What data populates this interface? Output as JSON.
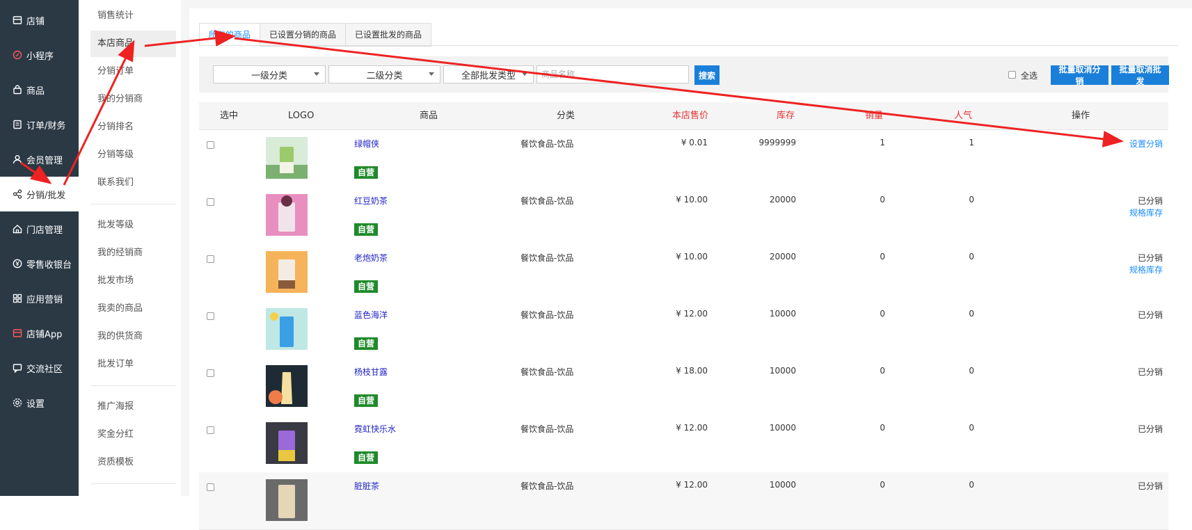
{
  "sidebar": {
    "items": [
      {
        "label": "店铺",
        "icon": "store-icon"
      },
      {
        "label": "小程序",
        "icon": "miniprogram-icon"
      },
      {
        "label": "商品",
        "icon": "bag-icon"
      },
      {
        "label": "订单/财务",
        "icon": "order-icon"
      },
      {
        "label": "会员管理",
        "icon": "user-icon"
      },
      {
        "label": "分销/批发",
        "icon": "share-icon"
      },
      {
        "label": "门店管理",
        "icon": "home-icon"
      },
      {
        "label": "零售收银台",
        "icon": "yen-icon"
      },
      {
        "label": "应用营销",
        "icon": "apps-icon"
      },
      {
        "label": "店铺App",
        "icon": "app-icon"
      },
      {
        "label": "交流社区",
        "icon": "chat-icon"
      },
      {
        "label": "设置",
        "icon": "gear-icon"
      }
    ]
  },
  "subnav": {
    "group1": [
      "销售统计",
      "本店商品",
      "分销订单",
      "我的分销商",
      "分销排名",
      "分销等级",
      "联系我们"
    ],
    "group2": [
      "批发等级",
      "我的经销商",
      "批发市场",
      "我卖的商品",
      "我的供货商",
      "批发订单"
    ],
    "group3": [
      "推广海报",
      "奖金分红",
      "资质模板"
    ]
  },
  "tabs": [
    "所有的商品",
    "已设置分销的商品",
    "已设置批发的商品"
  ],
  "filters": {
    "cat1": "一级分类",
    "cat2": "二级分类",
    "type": "全部批发类型",
    "search_placeholder": "商品名称",
    "search_btn": "搜索",
    "select_all": "全选",
    "batch_cancel_dist": "批量取消分销",
    "batch_cancel_wholesale": "批量取消批发"
  },
  "table": {
    "headers": [
      "选中",
      "LOGO",
      "商品",
      "分类",
      "本店售价",
      "库存",
      "销量",
      "人气",
      "操作"
    ],
    "badge": "自营",
    "rows": [
      {
        "name": "绿帽侠",
        "category": "餐饮食品-饮品",
        "price": "¥ 0.01",
        "stock": "9999999",
        "sales": "1",
        "pop": "1",
        "op1": "设置分销",
        "op2": ""
      },
      {
        "name": "红豆奶茶",
        "category": "餐饮食品-饮品",
        "price": "¥ 10.00",
        "stock": "20000",
        "sales": "0",
        "pop": "0",
        "op1": "已分销",
        "op2": "规格库存"
      },
      {
        "name": "老炮奶茶",
        "category": "餐饮食品-饮品",
        "price": "¥ 10.00",
        "stock": "20000",
        "sales": "0",
        "pop": "0",
        "op1": "已分销",
        "op2": "规格库存"
      },
      {
        "name": "蓝色海洋",
        "category": "餐饮食品-饮品",
        "price": "¥ 12.00",
        "stock": "10000",
        "sales": "0",
        "pop": "0",
        "op1": "已分销",
        "op2": ""
      },
      {
        "name": "杨枝甘露",
        "category": "餐饮食品-饮品",
        "price": "¥ 18.00",
        "stock": "10000",
        "sales": "0",
        "pop": "0",
        "op1": "已分销",
        "op2": ""
      },
      {
        "name": "霓虹快乐水",
        "category": "餐饮食品-饮品",
        "price": "¥ 12.00",
        "stock": "10000",
        "sales": "0",
        "pop": "0",
        "op1": "已分销",
        "op2": ""
      },
      {
        "name": "脏脏茶",
        "category": "餐饮食品-饮品",
        "price": "¥ 12.00",
        "stock": "10000",
        "sales": "0",
        "pop": "0",
        "op1": "已分销",
        "op2": ""
      }
    ]
  },
  "colors": {
    "sidebar": "#2b3945",
    "accent": "#1a7fd9",
    "badge": "#1f8a2a",
    "price_red": "#e53333",
    "annotation": "#ee2222"
  }
}
